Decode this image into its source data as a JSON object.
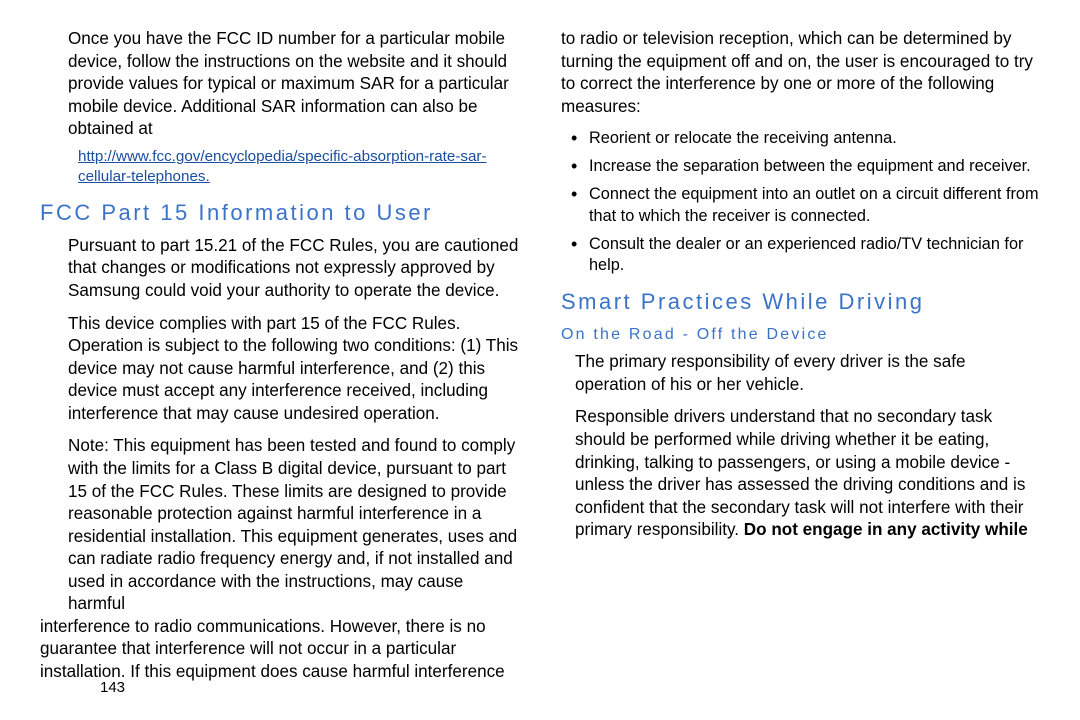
{
  "col1": {
    "p1": "Once you have the FCC ID number for a particular mobile device, follow the instructions on the website and it should provide values for typical or maximum SAR for a particular mobile device. Additional SAR information can also be obtained at",
    "link": "http://www.fcc.gov/encyclopedia/specific-absorption-rate-sar-cellular-telephones.",
    "h2": "FCC Part 15 Information to User",
    "p2": "Pursuant to part 15.21 of the FCC Rules, you are cautioned that changes or modifications not expressly approved by Samsung could void your authority to operate the device.",
    "p3": "This device complies with part 15 of the FCC Rules. Operation is subject to the following two conditions: (1) This device may not cause harmful interference, and (2) this device must accept any interference received, including interference that may cause undesired operation.",
    "p4": "Note: This equipment has been tested and found to comply with the limits for a Class B digital device, pursuant to part 15 of the FCC Rules. These limits are designed to provide reasonable protection against harmful interference in a residential installation. This equipment generates, uses and can radiate radio frequency energy and, if not installed and used in accordance with the instructions, may cause harmful"
  },
  "col2": {
    "p4cont": "interference to radio communications. However, there is no guarantee that interference will not occur in a particular installation. If this equipment does cause harmful interference to radio or television reception, which can be determined by turning the equipment off and on, the user is encouraged to try to correct the interference by one or more of the following measures:",
    "bullets": [
      "Reorient or relocate the receiving antenna.",
      "Increase the separation between the equipment and receiver.",
      "Connect the equipment into an outlet on a circuit different from that to which the receiver is connected.",
      "Consult the dealer or an experienced radio/TV technician for help."
    ],
    "h2": "Smart Practices While Driving",
    "h3": "On the Road - Off the Device",
    "p5": "The primary responsibility of every driver is the safe operation of his or her vehicle.",
    "p6a": "Responsible drivers understand that no secondary task should be performed while driving whether it be eating, drinking, talking to passengers, or using a mobile device - unless the driver has assessed the driving conditions and is confident that the secondary task will not interfere with their primary responsibility. ",
    "p6b": "Do not engage in any activity while"
  },
  "pagenum": "143"
}
